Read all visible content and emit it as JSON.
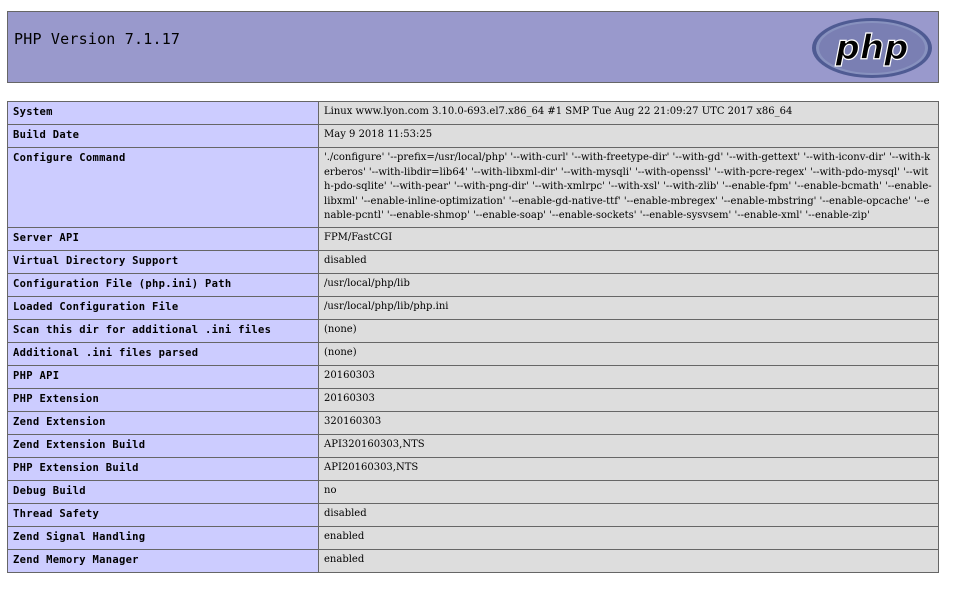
{
  "header": {
    "title": "PHP Version 7.1.17",
    "logo_text": "php"
  },
  "rows": [
    {
      "label": "System",
      "value": "Linux www.lyon.com 3.10.0-693.el7.x86_64 #1 SMP Tue Aug 22 21:09:27 UTC 2017 x86_64"
    },
    {
      "label": "Build Date",
      "value": "May 9 2018 11:53:25"
    },
    {
      "label": "Configure Command",
      "value": "'./configure' '--prefix=/usr/local/php' '--with-curl' '--with-freetype-dir' '--with-gd' '--with-gettext' '--with-iconv-dir' '--with-kerberos' '--with-libdir=lib64' '--with-libxml-dir' '--with-mysqli' '--with-openssl' '--with-pcre-regex' '--with-pdo-mysql' '--with-pdo-sqlite' '--with-pear' '--with-png-dir' '--with-xmlrpc' '--with-xsl' '--with-zlib' '--enable-fpm' '--enable-bcmath' '--enable-libxml' '--enable-inline-optimization' '--enable-gd-native-ttf' '--enable-mbregex' '--enable-mbstring' '--enable-opcache' '--enable-pcntl' '--enable-shmop' '--enable-soap' '--enable-sockets' '--enable-sysvsem' '--enable-xml' '--enable-zip'"
    },
    {
      "label": "Server API",
      "value": "FPM/FastCGI"
    },
    {
      "label": "Virtual Directory Support",
      "value": "disabled"
    },
    {
      "label": "Configuration File (php.ini) Path",
      "value": "/usr/local/php/lib"
    },
    {
      "label": "Loaded Configuration File",
      "value": "/usr/local/php/lib/php.ini"
    },
    {
      "label": "Scan this dir for additional .ini files",
      "value": "(none)"
    },
    {
      "label": "Additional .ini files parsed",
      "value": "(none)"
    },
    {
      "label": "PHP API",
      "value": "20160303"
    },
    {
      "label": "PHP Extension",
      "value": "20160303"
    },
    {
      "label": "Zend Extension",
      "value": "320160303"
    },
    {
      "label": "Zend Extension Build",
      "value": "API320160303,NTS"
    },
    {
      "label": "PHP Extension Build",
      "value": "API20160303,NTS"
    },
    {
      "label": "Debug Build",
      "value": "no"
    },
    {
      "label": "Thread Safety",
      "value": "disabled"
    },
    {
      "label": "Zend Signal Handling",
      "value": "enabled"
    },
    {
      "label": "Zend Memory Manager",
      "value": "enabled"
    }
  ],
  "colors": {
    "header_bg": "#9999cc",
    "label_bg": "#ccccff",
    "value_bg": "#dddddd",
    "logo_bg": "#7a7fb3",
    "logo_ring": "#4f5b93"
  }
}
